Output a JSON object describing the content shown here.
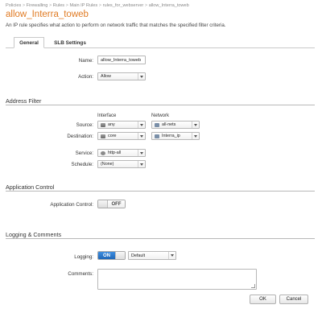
{
  "breadcrumb": [
    "Policies",
    "Firewalling",
    "Rules",
    "Main IP Rules",
    "rules_for_webserver",
    "allow_Interra_toweb"
  ],
  "breadcrumb_separator": ">",
  "page": {
    "title": "allow_Interra_toweb",
    "description": "An IP rule specifies what action to perform on network traffic that matches the specified filter criteria."
  },
  "tabs": [
    {
      "label": "General",
      "active": true
    },
    {
      "label": "SLB Settings",
      "active": false
    }
  ],
  "general": {
    "name_label": "Name:",
    "name_value": "allow_Interra_toweb",
    "action_label": "Action:",
    "action_value": "Allow"
  },
  "address_filter": {
    "heading": "Address Filter",
    "col_interface": "Interface",
    "col_network": "Network",
    "source_label": "Source:",
    "source_interface": "any",
    "source_network": "all-nets",
    "destination_label": "Destination:",
    "destination_interface": "core",
    "destination_network": "Interra_ip",
    "service_label": "Service:",
    "service_value": "http-all",
    "schedule_label": "Schedule:",
    "schedule_value": "(None)"
  },
  "application_control": {
    "heading": "Application Control",
    "label": "Application Control:",
    "state": "OFF"
  },
  "logging": {
    "heading": "Logging & Comments",
    "logging_label": "Logging:",
    "logging_state": "ON",
    "logging_profile": "Default",
    "comments_label": "Comments:",
    "comments_value": ""
  },
  "footer": {
    "ok_label": "OK",
    "cancel_label": "Cancel"
  },
  "colors": {
    "title": "#e07b24",
    "toggle_on": "#1f68b8"
  }
}
